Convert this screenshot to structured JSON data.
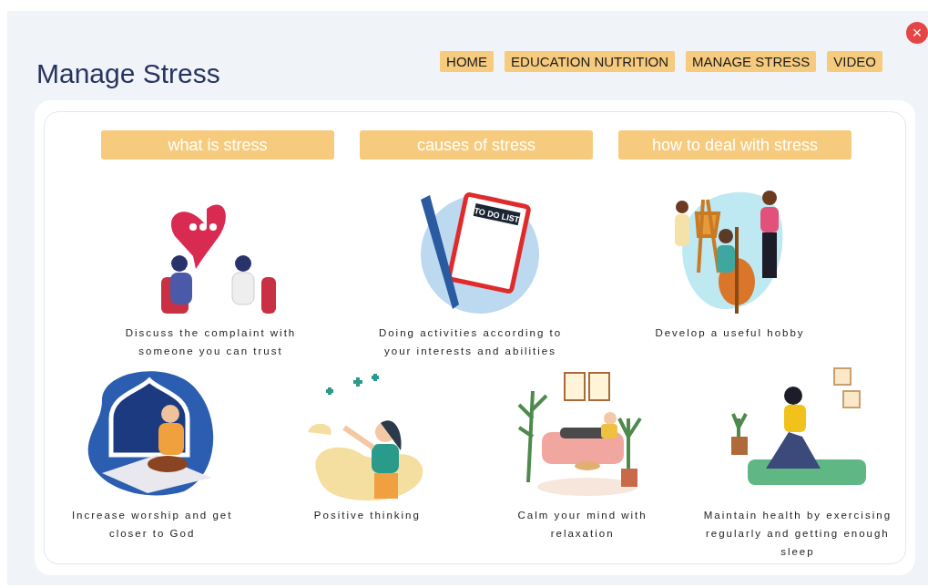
{
  "title": "Manage Stress",
  "nav": [
    "HOME",
    "EDUCATION NUTRITION",
    "MANAGE STRESS",
    "VIDEO"
  ],
  "close": "×",
  "tabs": [
    "what is stress",
    "causes of stress",
    "how to deal with stress"
  ],
  "rows": [
    [
      {
        "kind": "talk",
        "caption": "Discuss the complaint with someone you can trust"
      },
      {
        "kind": "todo",
        "caption": "Doing activities according to your interests and abilities",
        "badge": "TO DO LIST"
      },
      {
        "kind": "hobby",
        "caption": "Develop a useful hobby"
      }
    ],
    [
      {
        "kind": "worship",
        "caption": "Increase worship and get closer to God"
      },
      {
        "kind": "positive",
        "caption": "Positive thinking"
      },
      {
        "kind": "relax",
        "caption": "Calm your mind with relaxation"
      },
      {
        "kind": "yoga",
        "caption": "Maintain health by exercising regularly and getting enough sleep"
      }
    ]
  ]
}
